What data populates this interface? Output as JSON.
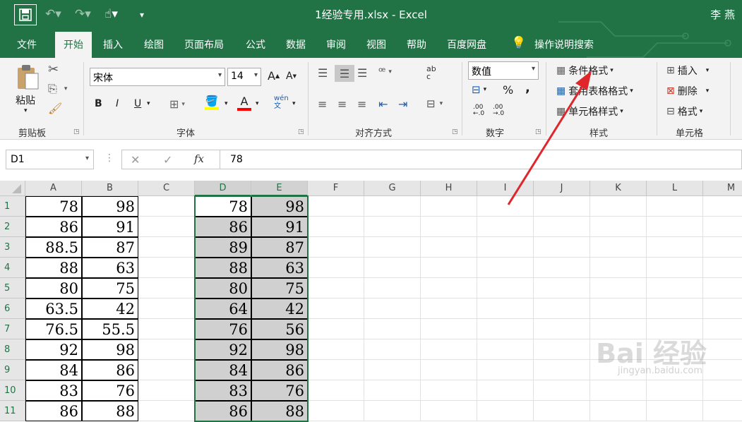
{
  "window": {
    "title": "1经验专用.xlsx  -  Excel",
    "user": "李 燕"
  },
  "menu": {
    "items": [
      "文件",
      "开始",
      "插入",
      "绘图",
      "页面布局",
      "公式",
      "数据",
      "审阅",
      "视图",
      "帮助",
      "百度网盘"
    ],
    "active": "开始",
    "tell_me": "操作说明搜索"
  },
  "ribbon": {
    "clipboard": {
      "paste_label": "粘贴",
      "group_label": "剪贴板"
    },
    "font": {
      "font_name": "宋体",
      "font_size": "14",
      "bold": "B",
      "italic": "I",
      "underline": "U",
      "grow": "A",
      "shrink": "A",
      "pinyin": "wén\n文",
      "font_color_glyph": "A",
      "group_label": "字体"
    },
    "alignment": {
      "group_label": "对齐方式",
      "wrap": "ab\nc"
    },
    "number": {
      "format": "数值",
      "percent": "%",
      "comma": ",",
      "inc_dec": ".00\n←.0",
      "dec_dec": ".00\n→.0",
      "group_label": "数字"
    },
    "styles": {
      "conditional": "条件格式",
      "table_format": "套用表格格式",
      "cell_styles": "单元格样式",
      "group_label": "样式"
    },
    "cells": {
      "insert": "插入",
      "delete": "删除",
      "format": "格式",
      "group_label": "单元格"
    },
    "colors": {
      "highlight_bar": "#ffff00",
      "font_bar": "#ff0000"
    }
  },
  "formula_bar": {
    "name_box": "D1",
    "cancel_glyph": "✕",
    "enter_glyph": "✓",
    "fx": "fx",
    "value": "78"
  },
  "sheet": {
    "columns": [
      "A",
      "B",
      "C",
      "D",
      "E",
      "F",
      "G",
      "H",
      "I",
      "J",
      "K",
      "L",
      "M"
    ],
    "rows": [
      "1",
      "2",
      "3",
      "4",
      "5",
      "6",
      "7",
      "8",
      "9",
      "10",
      "11"
    ],
    "col_a": [
      "78",
      "86",
      "88.5",
      "88",
      "80",
      "63.5",
      "76.5",
      "92",
      "84",
      "83",
      "86"
    ],
    "col_b": [
      "98",
      "91",
      "87",
      "63",
      "75",
      "42",
      "55.5",
      "98",
      "86",
      "76",
      "88"
    ],
    "col_d": [
      "78",
      "86",
      "89",
      "88",
      "80",
      "64",
      "76",
      "92",
      "84",
      "83",
      "86"
    ],
    "col_e": [
      "98",
      "91",
      "87",
      "63",
      "75",
      "42",
      "56",
      "98",
      "86",
      "76",
      "88"
    ]
  },
  "watermark": {
    "brand": "Bai 经验",
    "url": "jingyan.baidu.com"
  },
  "accent": {
    "excel_green": "#217346",
    "arrow_red": "#e0262b"
  }
}
